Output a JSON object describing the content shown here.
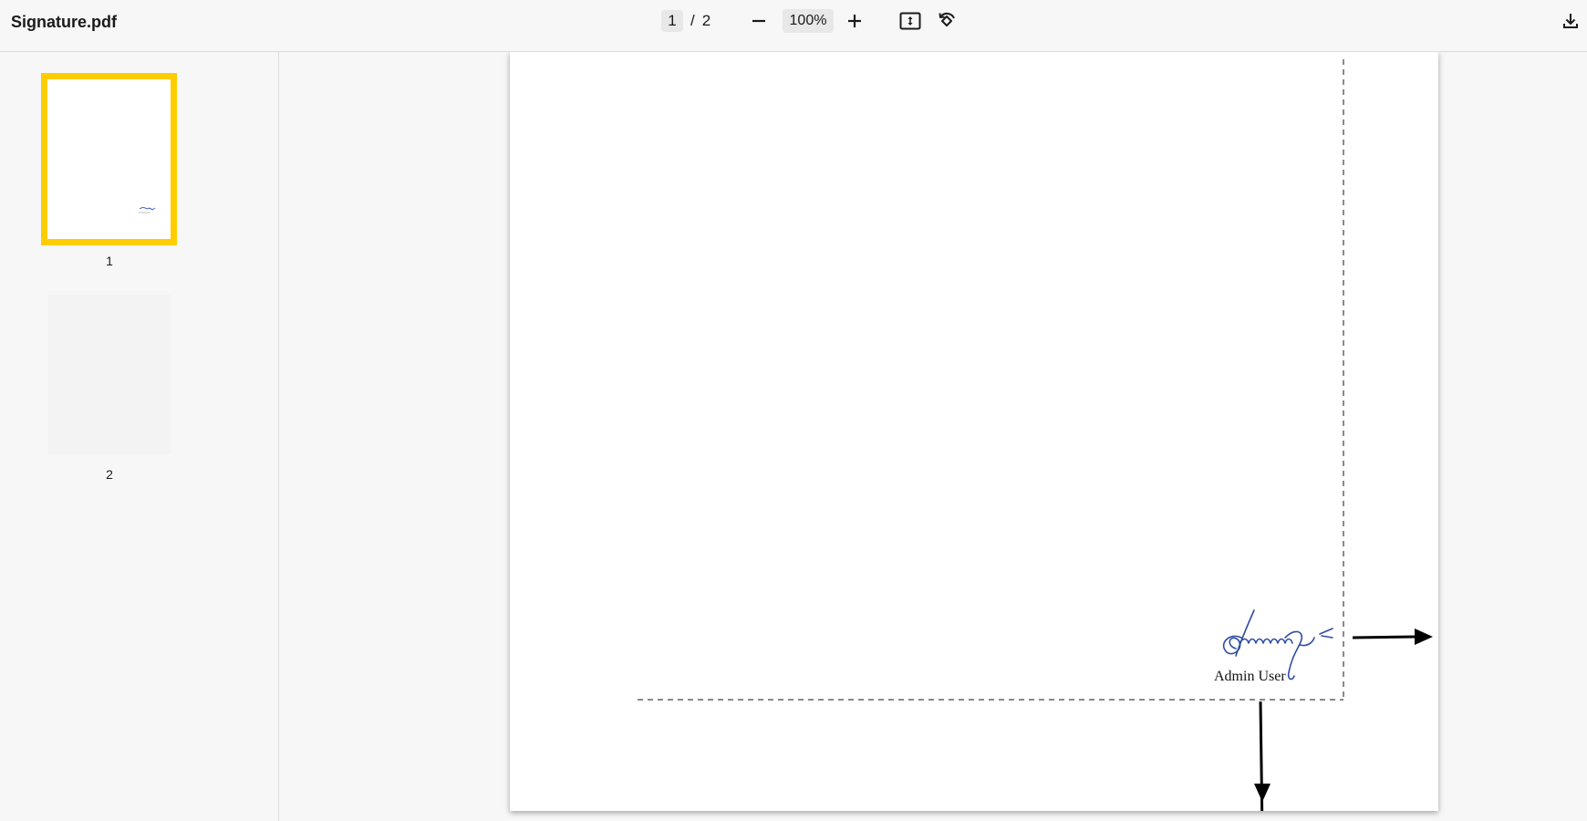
{
  "window": {
    "title": "Signature.pdf"
  },
  "toolbar": {
    "current_page": "1",
    "separator": "/",
    "total_pages": "2",
    "zoom": "100%",
    "icons": {
      "zoom_out": "minus-icon",
      "zoom_in": "plus-icon",
      "fit": "fit-page-icon",
      "rotate": "rotate-icon",
      "download": "download-icon"
    }
  },
  "sidebar": {
    "thumbnails": [
      {
        "label": "1",
        "selected": true
      },
      {
        "label": "2",
        "selected": false
      }
    ]
  },
  "document": {
    "signer_name": "Admin User"
  },
  "colors": {
    "accent": "#ffcc00",
    "signature_ink": "#2f4da0",
    "background": "#f7f7f7"
  }
}
